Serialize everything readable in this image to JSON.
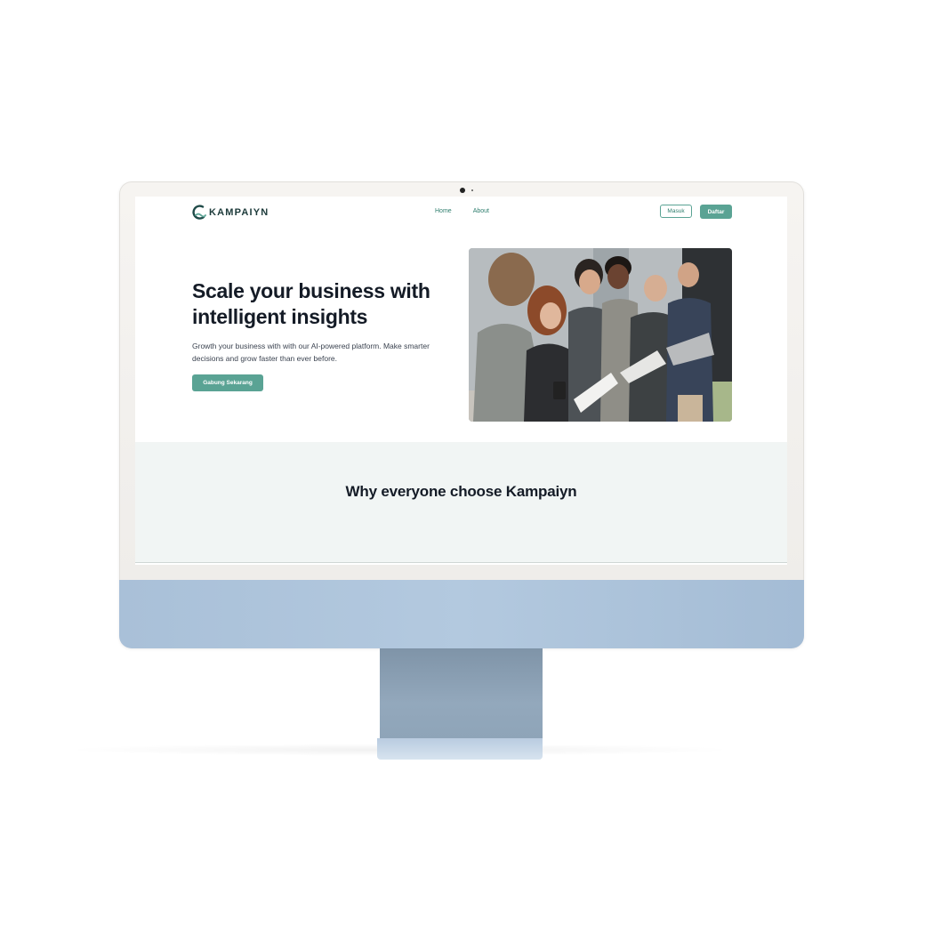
{
  "brand": {
    "name": "KAMPAIYN",
    "accent_color": "#5aa394",
    "logo_icon": "crescent-wave-icon"
  },
  "nav": {
    "links": [
      {
        "label": "Home"
      },
      {
        "label": "About"
      }
    ],
    "login_label": "Masuk",
    "register_label": "Daftar"
  },
  "hero": {
    "title": "Scale your business with intelligent insights",
    "description": "Growth your business with with our AI-powered platform. Make smarter decisions and grow faster than ever before.",
    "cta_label": "Gabung Sekarang",
    "image": "team-meeting-photo"
  },
  "why": {
    "title": "Why everyone choose Kampaiyn"
  }
}
